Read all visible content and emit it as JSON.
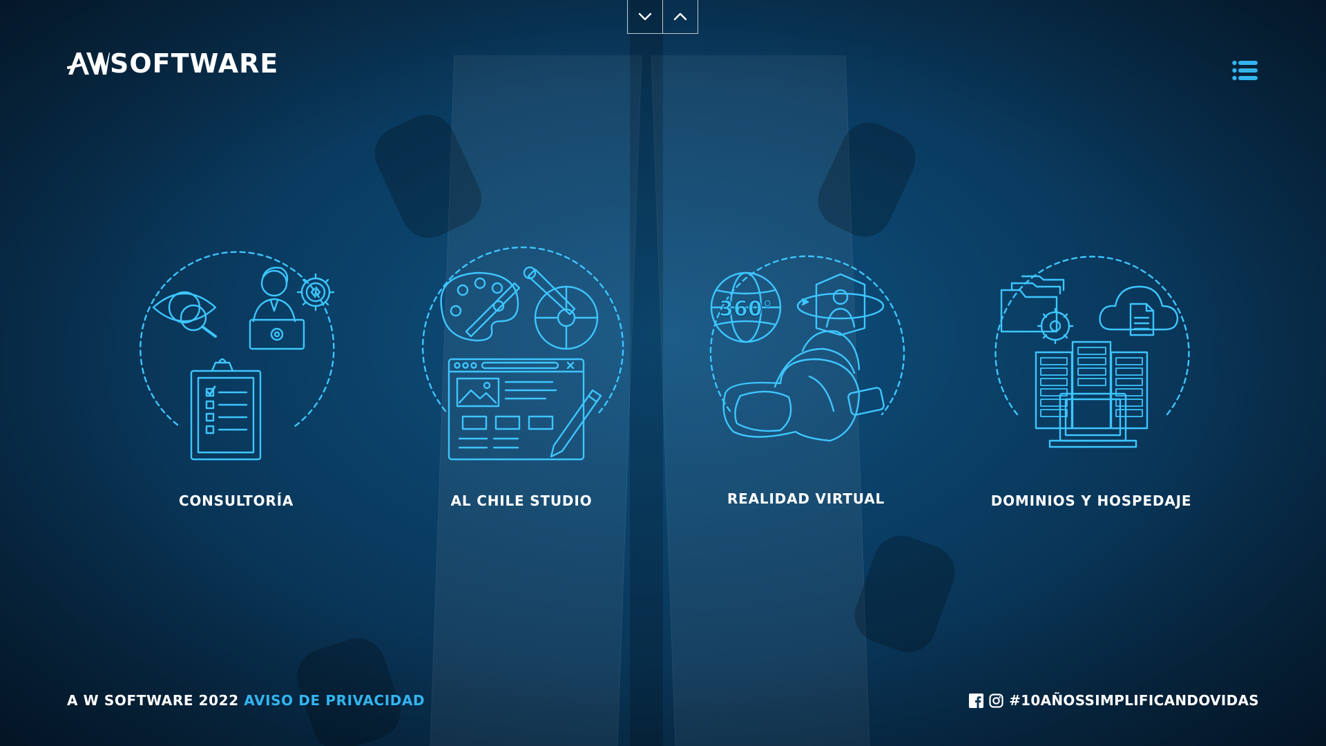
{
  "brand": {
    "logo_text": "SOFTWARE",
    "accent_color": "#33b5f0",
    "line_color": "#3ec6ff"
  },
  "nav": {
    "scroll_down_icon": "chevron-down-icon",
    "scroll_up_icon": "chevron-up-icon",
    "menu_icon": "list-menu-icon"
  },
  "services": [
    {
      "label": "CONSULTORÍA",
      "icon": "consulting-illustration"
    },
    {
      "label": "AL CHILE STUDIO",
      "icon": "design-studio-illustration"
    },
    {
      "label": "REALIDAD VIRTUAL",
      "icon": "virtual-reality-illustration",
      "badge": "360°"
    },
    {
      "label": "DOMINIOS Y HOSPEDAJE",
      "icon": "hosting-illustration"
    }
  ],
  "footer": {
    "copyright": "A W SOFTWARE 2022",
    "privacy_link": "AVISO DE PRIVACIDAD",
    "hashtag": "#10AÑOSSIMPLIFICANDOVIDAS",
    "social": [
      "facebook-icon",
      "instagram-icon"
    ]
  }
}
